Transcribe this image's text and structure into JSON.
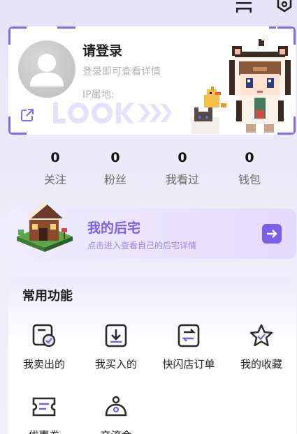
{
  "topbar": {
    "icons": [
      "scan-icon",
      "settings-icon"
    ]
  },
  "profile": {
    "title": "请登录",
    "subtitle": "登录即可查看详情",
    "ip_location": "IP属地:",
    "watermark": "LOOK"
  },
  "stats": [
    {
      "value": "0",
      "label": "关注"
    },
    {
      "value": "0",
      "label": "粉丝"
    },
    {
      "value": "0",
      "label": "我看过"
    },
    {
      "value": "0",
      "label": "钱包"
    }
  ],
  "home": {
    "title": "我的后宅",
    "subtitle": "点击进入查看自己的后宅详情"
  },
  "functions": {
    "title": "常用功能",
    "items": [
      {
        "label": "我卖出的",
        "icon": "sold-icon"
      },
      {
        "label": "我买入的",
        "icon": "bought-icon"
      },
      {
        "label": "快闪店订单",
        "icon": "popup-order-icon"
      },
      {
        "label": "我的收藏",
        "icon": "star-icon"
      },
      {
        "label": "优惠券",
        "icon": "coupon-icon"
      },
      {
        "label": "交流会",
        "icon": "meetup-icon"
      }
    ]
  },
  "colors": {
    "accent": "#7a5fe8",
    "brand_purple": "#7b6cf0"
  }
}
